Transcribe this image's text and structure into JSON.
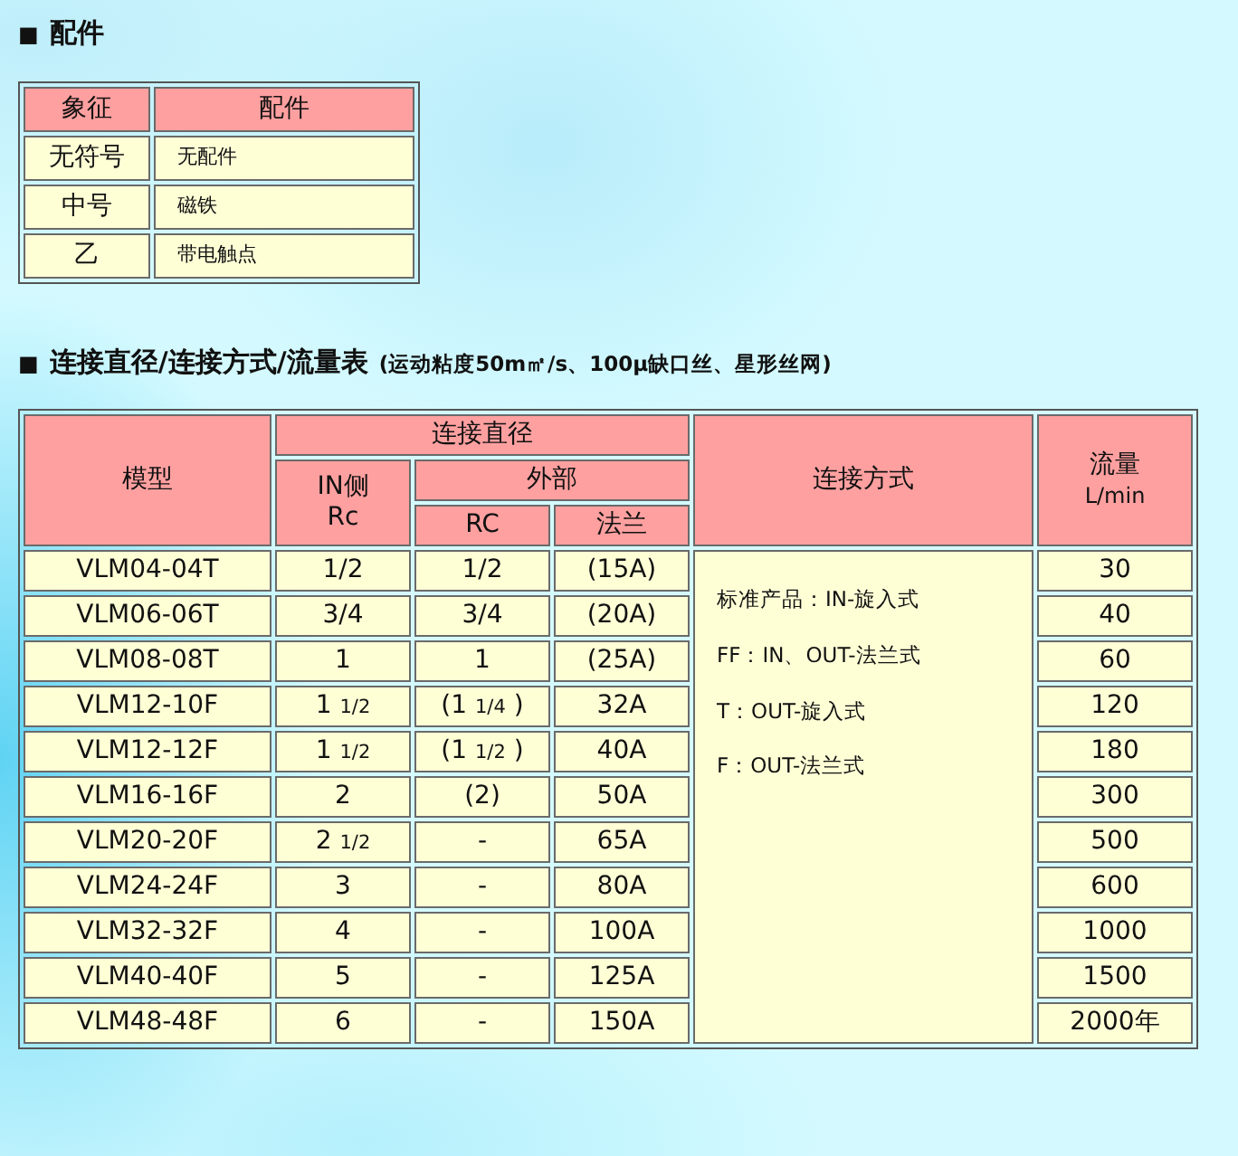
{
  "accessories": {
    "bullet": "■",
    "title": "配件",
    "columns": [
      "象征",
      "配件"
    ],
    "rows": [
      {
        "symbol": "无符号",
        "accessory": "无配件"
      },
      {
        "symbol": "中号",
        "accessory": "磁铁"
      },
      {
        "symbol": "乙",
        "accessory": "带电触点"
      }
    ]
  },
  "flow_table": {
    "bullet": "■",
    "title": "连接直径/连接方式/流量表",
    "note": "(运动粘度50m㎡/s、100μ缺口丝、星形丝网)",
    "headers": {
      "model": "模型",
      "diameter": "连接直径",
      "in_side": [
        "IN侧",
        "Rc"
      ],
      "outer": "外部",
      "rc": "RC",
      "flange": "法兰",
      "method": "连接方式",
      "flow": "流量",
      "flow_unit": "L/min"
    },
    "method_notes": [
      "标准产品：IN-旋入式",
      "FF：IN、OUT-法兰式",
      "T：OUT-旋入式",
      "F：OUT-法兰式"
    ],
    "rows": [
      {
        "model": "VLM04-04T",
        "in_side": {
          "main": "1/2"
        },
        "rc": {
          "main": "1/2"
        },
        "flange": "(15A)",
        "flow": "30"
      },
      {
        "model": "VLM06-06T",
        "in_side": {
          "main": "3/4"
        },
        "rc": {
          "main": "3/4"
        },
        "flange": "(20A)",
        "flow": "40"
      },
      {
        "model": "VLM08-08T",
        "in_side": {
          "main": "1"
        },
        "rc": {
          "main": "1"
        },
        "flange": "(25A)",
        "flow": "60"
      },
      {
        "model": "VLM12-10F",
        "in_side": {
          "main": "1",
          "fraction": "1/2"
        },
        "rc": {
          "main": "(1",
          "fraction": "1/4",
          "end": ")"
        },
        "flange": "32A",
        "flow": "120"
      },
      {
        "model": "VLM12-12F",
        "in_side": {
          "main": "1",
          "fraction": "1/2"
        },
        "rc": {
          "main": "(1",
          "fraction": "1/2",
          "end": ")"
        },
        "flange": "40A",
        "flow": "180"
      },
      {
        "model": "VLM16-16F",
        "in_side": {
          "main": "2"
        },
        "rc": {
          "main": "(2)"
        },
        "flange": "50A",
        "flow": "300"
      },
      {
        "model": "VLM20-20F",
        "in_side": {
          "main": "2",
          "fraction": "1/2"
        },
        "rc": {
          "main": "-"
        },
        "flange": "65A",
        "flow": "500"
      },
      {
        "model": "VLM24-24F",
        "in_side": {
          "main": "3"
        },
        "rc": {
          "main": "-"
        },
        "flange": "80A",
        "flow": "600"
      },
      {
        "model": "VLM32-32F",
        "in_side": {
          "main": "4"
        },
        "rc": {
          "main": "-"
        },
        "flange": "100A",
        "flow": "1000"
      },
      {
        "model": "VLM40-40F",
        "in_side": {
          "main": "5"
        },
        "rc": {
          "main": "-"
        },
        "flange": "125A",
        "flow": "1500"
      },
      {
        "model": "VLM48-48F",
        "in_side": {
          "main": "6"
        },
        "rc": {
          "main": "-"
        },
        "flange": "150A",
        "flow": "2000年"
      }
    ]
  }
}
